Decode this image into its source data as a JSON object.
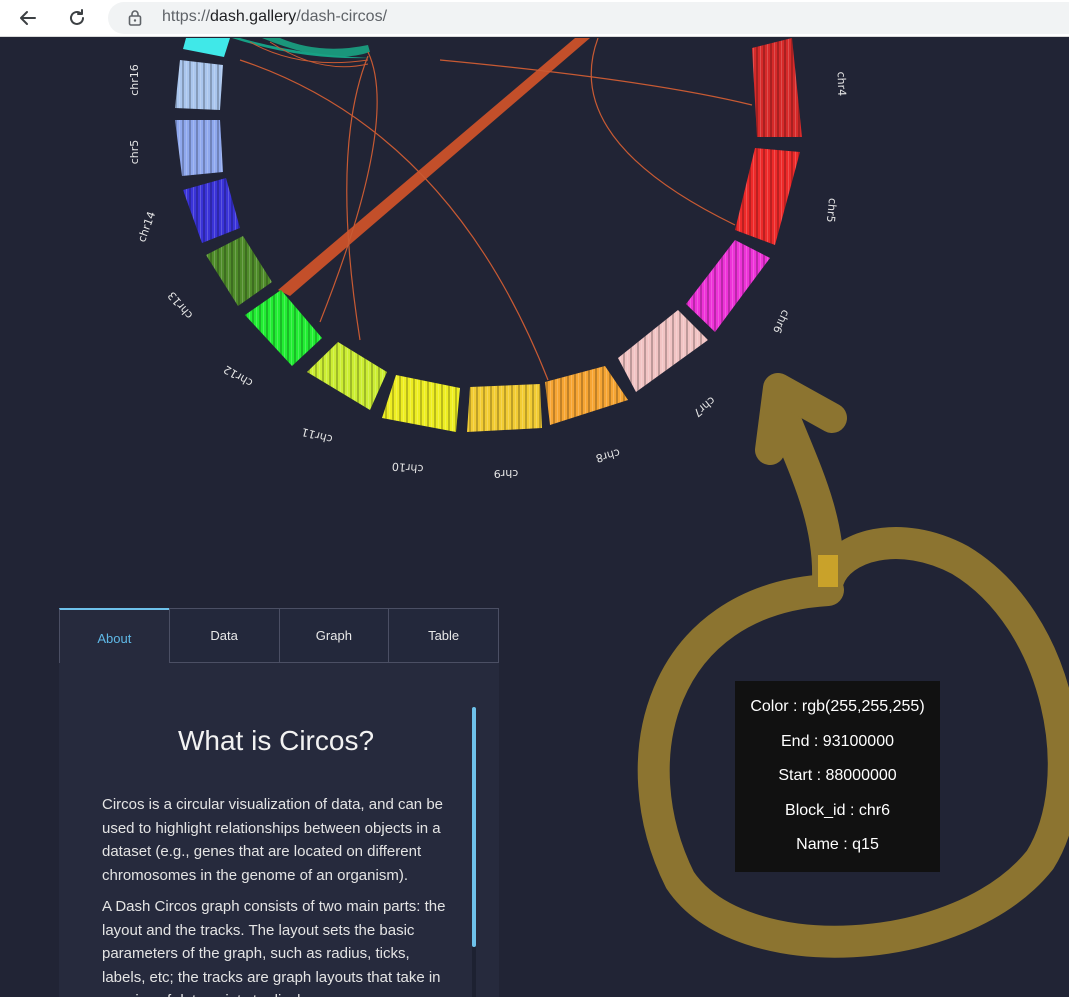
{
  "browser": {
    "url_prefix": "https://",
    "url_host": "dash.gallery",
    "url_path": "/dash-circos/"
  },
  "colors": {
    "background": "#212435",
    "accent": "#6ec1ea",
    "chord": "#c8502a",
    "annotation": "#8c7430"
  },
  "circos": {
    "ideogram_labels": {
      "chr16": "chr16",
      "chr15": "chr5",
      "chr14": "chr14",
      "chr13": "chr13",
      "chr12": "chr12",
      "chr11": "chr11",
      "chr10": "chr10",
      "chr9": "chr9",
      "chr8": "chr8",
      "chr7": "chr7",
      "chr6": "chr6",
      "chr5": "chr5",
      "chr4": "chr4"
    }
  },
  "tooltip": {
    "color": "Color : rgb(255,255,255)",
    "end": "End : 93100000",
    "start": "Start : 88000000",
    "block_id": "Block_id : chr6",
    "name": "Name : q15"
  },
  "tabs": {
    "about": "About",
    "data": "Data",
    "graph": "Graph",
    "table": "Table"
  },
  "about": {
    "title": "What is Circos?",
    "p1": "Circos is a circular visualization of data, and can be used to highlight relationships between objects in a dataset (e.g., genes that are located on different chromosomes in the genome of an organism).",
    "p2": "A Dash Circos graph consists of two main parts: the layout and the tracks. The layout sets the basic parameters of the graph, such as radius, ticks, labels, etc; the tracks are graph layouts that take in a series of data points to display."
  }
}
